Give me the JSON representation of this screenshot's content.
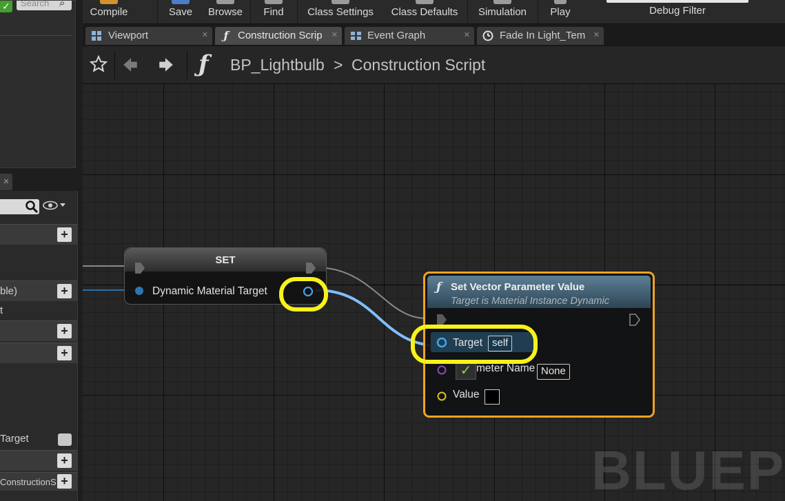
{
  "toolbar": {
    "buttons": [
      {
        "label": "Compile"
      },
      {
        "label": "Save"
      },
      {
        "label": "Browse"
      },
      {
        "label": "Find"
      },
      {
        "label": "Class Settings"
      },
      {
        "label": "Class Defaults"
      },
      {
        "label": "Simulation"
      },
      {
        "label": "Play"
      }
    ],
    "debug_filter_label": "Debug Filter"
  },
  "tabs": [
    {
      "label": "Viewport",
      "icon": "viewport-icon",
      "active": false
    },
    {
      "label": "Construction Scrip",
      "icon": "function-icon",
      "active": true
    },
    {
      "label": "Event Graph",
      "icon": "event-graph-icon",
      "active": false
    },
    {
      "label": "Fade In Light_Tem",
      "icon": "timeline-icon",
      "active": false
    }
  ],
  "breadcrumb": {
    "blueprint": "BP_Lightbulb",
    "separator": ">",
    "graph": "Construction Script"
  },
  "graph": {
    "watermark": "BLUEPR",
    "set_node": {
      "title": "SET",
      "pin_label": "Dynamic Material Target"
    },
    "set_vector_node": {
      "title": "Set Vector Parameter Value",
      "subtitle": "Target is Material Instance Dynamic",
      "target_label": "Target",
      "target_value": "self",
      "param_label": "meter Name",
      "param_value": "None",
      "value_label": "Value",
      "value_color": "#000000"
    },
    "highlight_color": "#f8f21a",
    "wire_color": "#7fbfff"
  },
  "left_panel": {
    "search_placeholder": "Search",
    "partial_var": "ble)",
    "partial_row": "t",
    "target_label": "Target",
    "context_label": "ConstructionScrip"
  }
}
